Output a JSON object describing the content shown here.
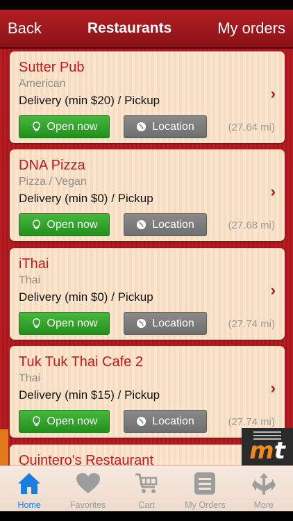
{
  "nav": {
    "back_label": "Back",
    "title": "Restaurants",
    "orders_label": "My orders"
  },
  "restaurants": [
    {
      "name": "Sutter Pub",
      "cuisine": "American",
      "delivery": "Delivery (min $20) / Pickup",
      "status_label": "Open now",
      "location_label": "Location",
      "distance": "(27.64 mi)"
    },
    {
      "name": "DNA Pizza",
      "cuisine": "Pizza / Vegan",
      "delivery": "Delivery (min $0) / Pickup",
      "status_label": "Open now",
      "location_label": "Location",
      "distance": "(27.68 mi)"
    },
    {
      "name": "iThai",
      "cuisine": "Thai",
      "delivery": "Delivery (min $0) / Pickup",
      "status_label": "Open now",
      "location_label": "Location",
      "distance": "(27.74 mi)"
    },
    {
      "name": "Tuk Tuk Thai Cafe 2",
      "cuisine": "Thai",
      "delivery": "Delivery (min $15) / Pickup",
      "status_label": "Open now",
      "location_label": "Location",
      "distance": "(27.74 mi)"
    },
    {
      "name": "Quintero's Restaurant"
    }
  ],
  "chevron_glyph": "›",
  "logo_text": "mt",
  "tabs": [
    {
      "label": "Home",
      "icon": "home-icon",
      "active": true
    },
    {
      "label": "Favorites",
      "icon": "heart-icon",
      "active": false
    },
    {
      "label": "Cart",
      "icon": "cart-icon",
      "active": false
    },
    {
      "label": "My Orders",
      "icon": "list-icon",
      "active": false
    },
    {
      "label": "More",
      "icon": "more-icon",
      "active": false
    }
  ],
  "colors": {
    "brand_red": "#b31f24",
    "open_green": "#34a52c",
    "location_gray": "#7d7d7d",
    "active_tab_blue": "#1a7de0"
  }
}
